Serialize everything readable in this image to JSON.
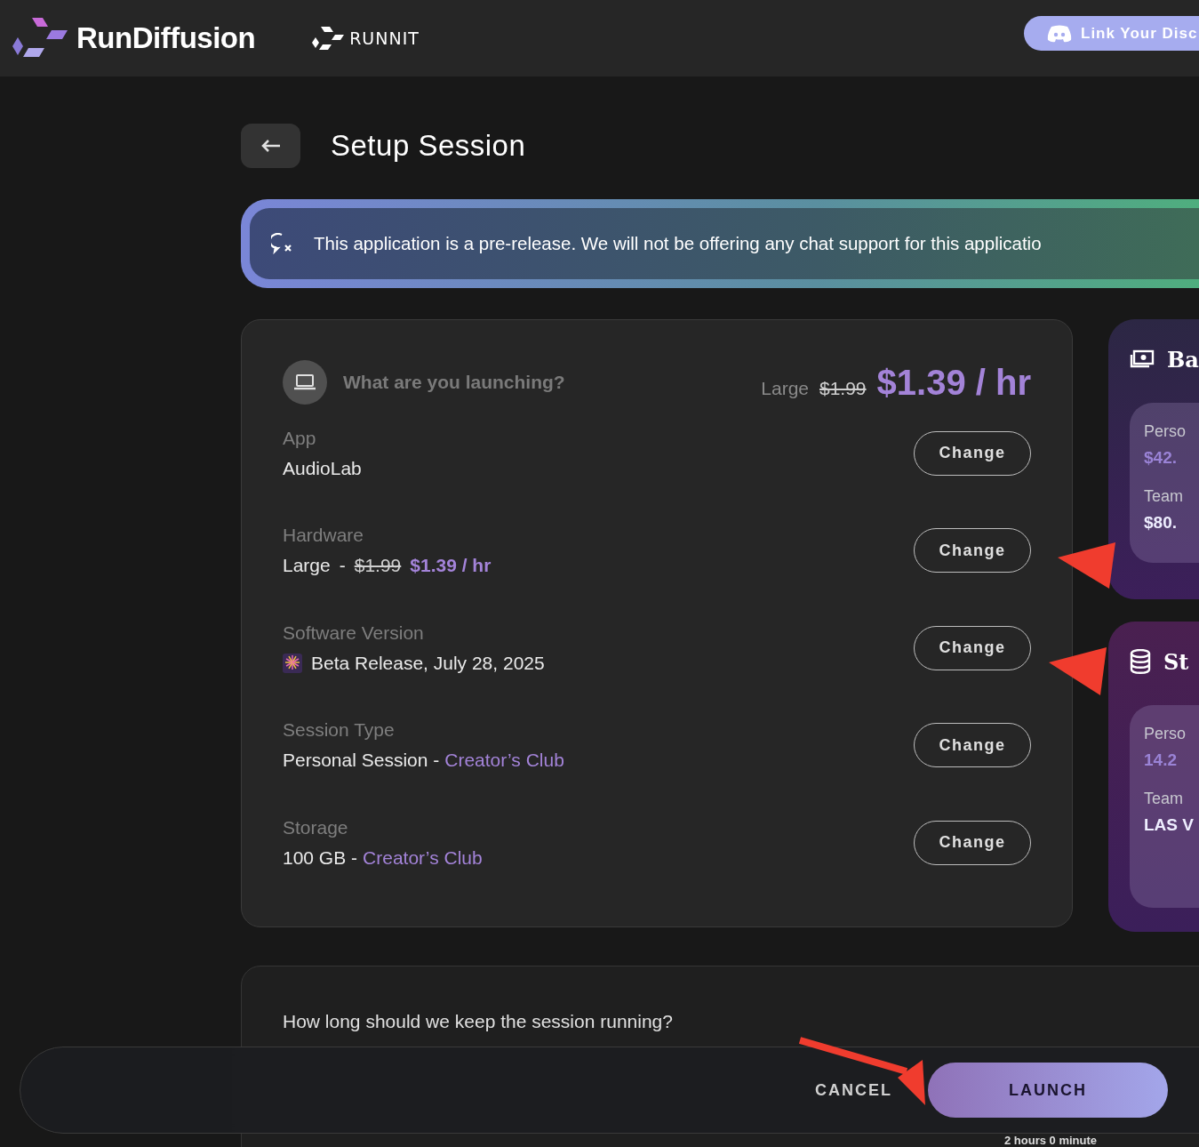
{
  "header": {
    "brand": "RunDiffusion",
    "runnit": "RUNNIT",
    "discord_button": "Link Your Disc"
  },
  "page_title": "Setup Session",
  "banner": {
    "text": "This application is a pre-release. We will not be offering any chat support for this applicatio"
  },
  "summary": {
    "question": "What are you launching?",
    "size": "Large",
    "old_price": "$1.99",
    "price": "$1.39 / hr",
    "rows": [
      {
        "kind": "plain",
        "label": "App",
        "value": "AudioLab",
        "button": "Change"
      },
      {
        "kind": "price",
        "label": "Hardware",
        "value": "Large",
        "separator": "-",
        "old_price": "$1.99",
        "price": "$1.39 / hr",
        "button": "Change"
      },
      {
        "kind": "icon",
        "label": "Software Version",
        "value": "Beta Release, July 28, 2025",
        "button": "Change"
      },
      {
        "kind": "plan",
        "label": "Session Type",
        "value": "Personal Session -",
        "plan": "Creator’s Club",
        "button": "Change"
      },
      {
        "kind": "plan",
        "label": "Storage",
        "value": "100 GB -",
        "plan": "Creator’s Club",
        "button": "Change"
      }
    ]
  },
  "side_cards": [
    {
      "kind": "balance",
      "title": "Ba",
      "items": [
        {
          "label": "Perso",
          "value": "$42.",
          "accent": true
        },
        {
          "label": "Team",
          "value": "$80.",
          "accent": false
        }
      ]
    },
    {
      "kind": "storage",
      "title": "St",
      "items": [
        {
          "label": "Perso",
          "value": "14.2",
          "accent": true
        },
        {
          "label": "Team",
          "value": "LAS V",
          "accent": false
        }
      ]
    }
  ],
  "duration": {
    "question": "How long should we keep the session running?",
    "reading": "2 hours 0 minute"
  },
  "footer": {
    "cancel": "CANCEL",
    "launch": "LAUNCH"
  }
}
